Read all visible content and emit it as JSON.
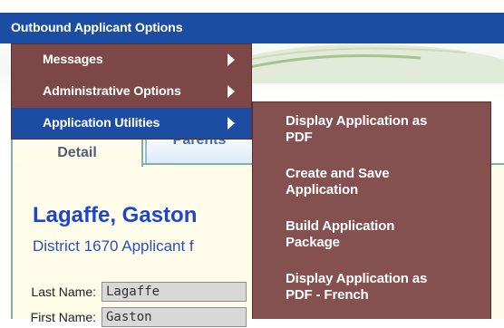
{
  "menubar": {
    "root_label": "Outbound Applicant Options"
  },
  "menus": {
    "level1": [
      {
        "label": "Messages"
      },
      {
        "label": "Administrative Options"
      },
      {
        "label": "Application Utilities"
      }
    ],
    "level2": [
      {
        "line1": "Display Application as",
        "line2": "PDF"
      },
      {
        "line1": "Create and Save",
        "line2": "Application"
      },
      {
        "line1": "Build Application",
        "line2": "Package"
      },
      {
        "line1": "Display Application as",
        "line2": "PDF - French"
      }
    ]
  },
  "tabs": [
    {
      "label": "Detail"
    },
    {
      "label": "Parents"
    }
  ],
  "applicant": {
    "name": "Lagaffe, Gaston",
    "subtitle": "District 1670 Applicant f"
  },
  "fields": [
    {
      "label": "Last Name:",
      "value": "Lagaffe"
    },
    {
      "label": "First Name:",
      "value": "Gaston"
    }
  ],
  "colors": {
    "menubar_blue": "#1b4ea3",
    "menu_maroon": "#7d4747",
    "name_blue": "#1f46c9"
  }
}
